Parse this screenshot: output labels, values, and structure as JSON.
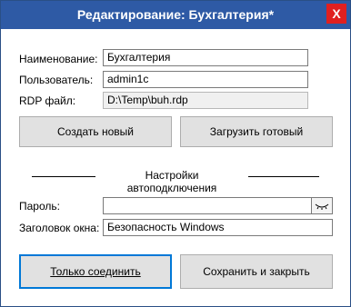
{
  "window": {
    "title": "Редактирование: Бухгалтерия*",
    "close_label": "X"
  },
  "form": {
    "name_label": "Наименование:",
    "name_value": "Бухгалтерия",
    "user_label": "Пользователь:",
    "user_value": "admin1c",
    "rdp_label": "RDP файл:",
    "rdp_value": "D:\\Temp\\buh.rdp"
  },
  "buttons": {
    "create_new": "Создать новый",
    "load_ready": "Загрузить готовый",
    "connect_only": "Только соединить",
    "save_close": "Сохранить и закрыть"
  },
  "autoconnect": {
    "section_title": "Настройки автоподключения",
    "password_label": "Пароль:",
    "password_value": "",
    "window_title_label": "Заголовок окна:",
    "window_title_value": "Безопасность Windows"
  },
  "icons": {
    "show_password": "eye-closed-icon"
  }
}
